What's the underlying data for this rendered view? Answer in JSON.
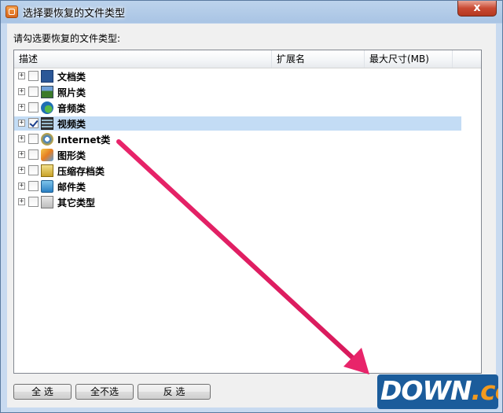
{
  "window": {
    "title": "选择要恢复的文件类型",
    "close_glyph": "x"
  },
  "prompt": "请勾选要恢复的文件类型:",
  "columns": {
    "description": "描述",
    "extension": "扩展名",
    "max_size": "最大尺寸(MB)"
  },
  "rows": [
    {
      "label": "文档类",
      "icon": "word-document-icon",
      "checked": false
    },
    {
      "label": "照片类",
      "icon": "photo-icon",
      "checked": false
    },
    {
      "label": "音频类",
      "icon": "audio-icon",
      "checked": false
    },
    {
      "label": "视频类",
      "icon": "film-icon",
      "checked": true,
      "selected": true
    },
    {
      "label": "Internet类",
      "icon": "internet-explorer-icon",
      "checked": false
    },
    {
      "label": "图形类",
      "icon": "graphics-icon",
      "checked": false
    },
    {
      "label": "压缩存档类",
      "icon": "archive-icon",
      "checked": false
    },
    {
      "label": "邮件类",
      "icon": "mail-icon",
      "checked": false
    },
    {
      "label": "其它类型",
      "icon": "other-file-icon",
      "checked": false
    }
  ],
  "expander_glyph": "+",
  "buttons": {
    "select_all": "全 选",
    "select_none": "全不选",
    "invert": "反 选"
  },
  "watermark": {
    "main": "DOWN",
    "suffix": ".cc"
  },
  "colors": {
    "selection": "#c3dcf5",
    "annotation_arrow": "#e8246a",
    "close_button": "#c94a33",
    "watermark_bg": "#1b5c9b"
  }
}
